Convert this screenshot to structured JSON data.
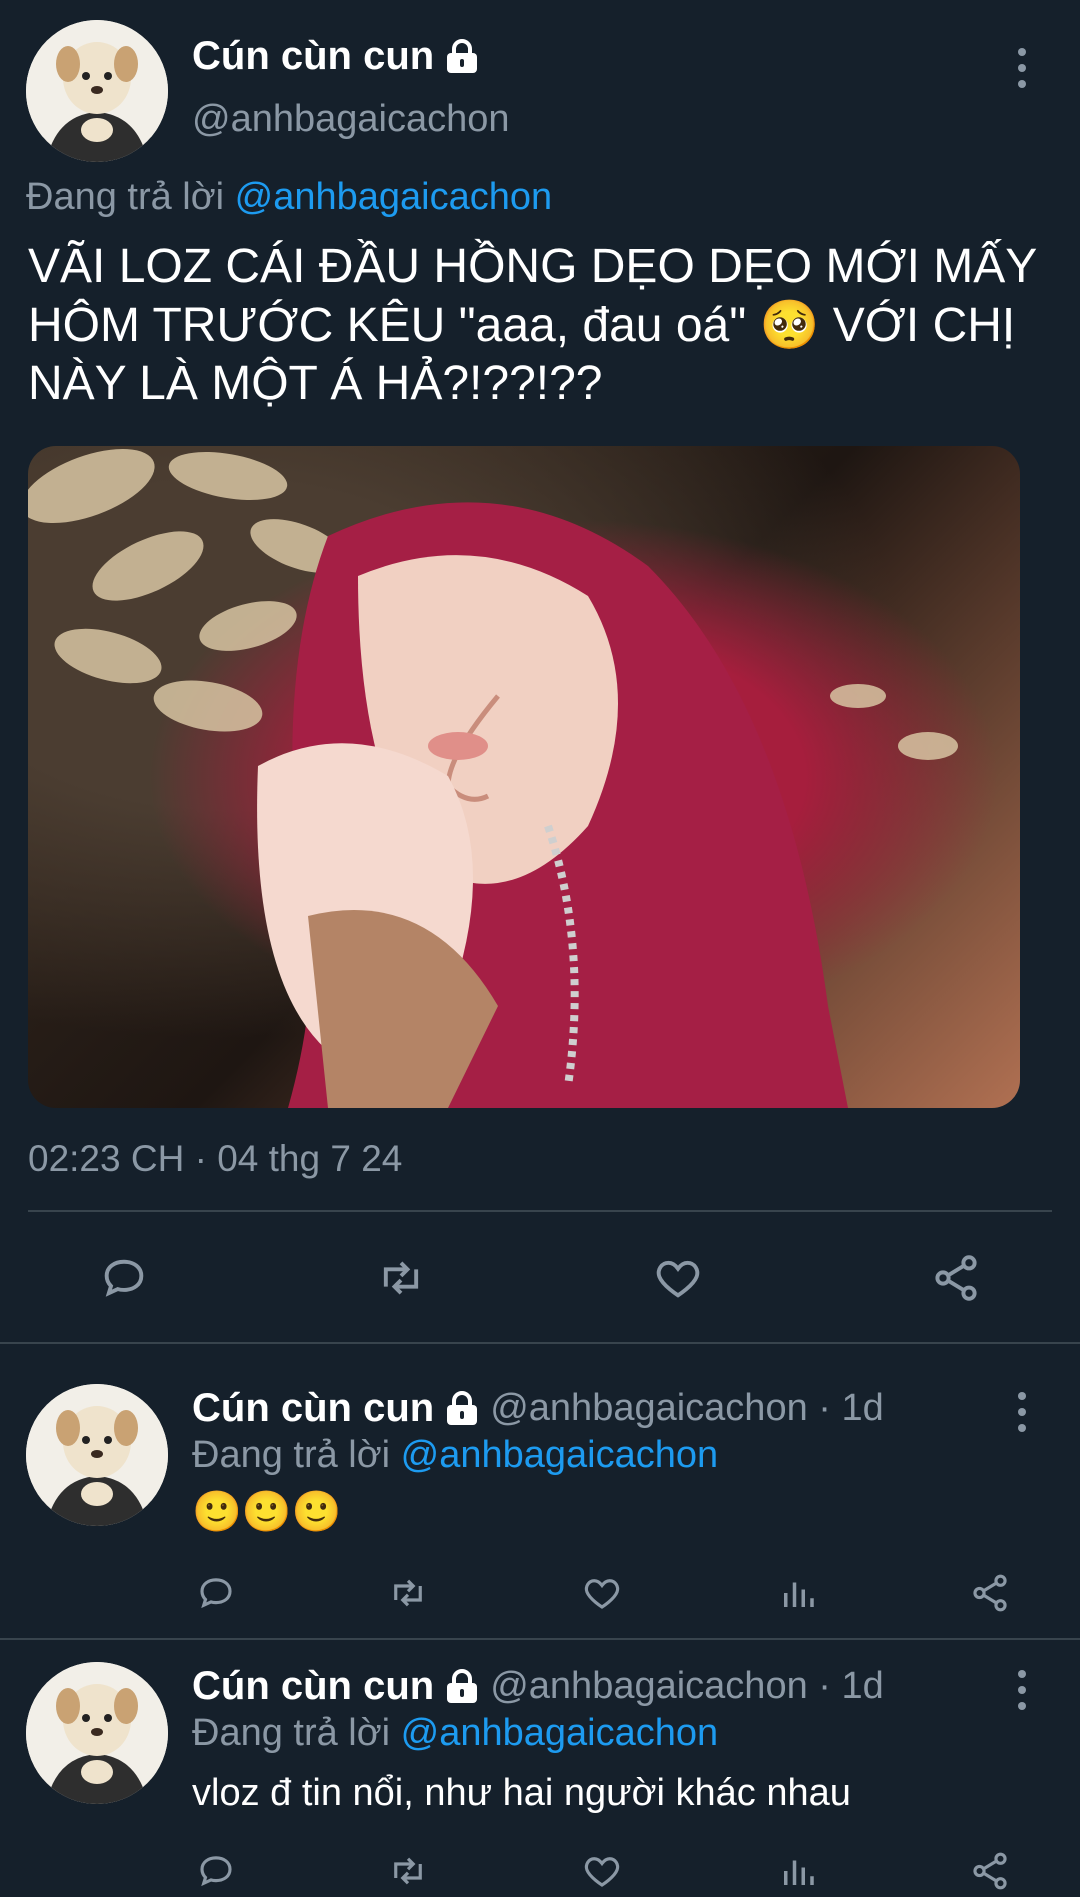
{
  "main_tweet": {
    "display_name": "Cún cùn cun",
    "handle": "@anhbagaicachon",
    "reply_prefix": "Đang trả lời",
    "reply_to": "@anhbagaicachon",
    "text_line1": "VÃI LOZ CÁI ĐẦU HỒNG DẸO DẸO MỚI MẤY",
    "text_line2_a": "HÔM TRƯỚC KÊU \"aaa, đau oá\"",
    "text_line2_emoji": "🥺",
    "text_line2_b": "VỚI CHỊ",
    "text_line3": "NÀY LÀ MỘT Á HẢ?!??!??",
    "timestamp": "02:23 CH · 04 thg 7 24"
  },
  "replies": [
    {
      "display_name": "Cún cùn cun",
      "handle_time": "@anhbagaicachon · 1d",
      "reply_prefix": "Đang trả lời",
      "reply_to": "@anhbagaicachon",
      "text": "🙂🙂🙂"
    },
    {
      "display_name": "Cún cùn cun",
      "handle_time": "@anhbagaicachon · 1d",
      "reply_prefix": "Đang trả lời",
      "reply_to": "@anhbagaicachon",
      "text": "vloz đ tin nổi, như hai người khác nhau"
    }
  ],
  "icons": {
    "reply": "reply-icon",
    "retweet": "retweet-icon",
    "like": "like-icon",
    "views": "analytics-icon",
    "share": "share-icon",
    "more": "more-icon",
    "lock": "lock-icon"
  },
  "colors": {
    "background": "#15202b",
    "link": "#1d9bf0",
    "muted": "#8b98a5",
    "divider": "#38444d"
  }
}
